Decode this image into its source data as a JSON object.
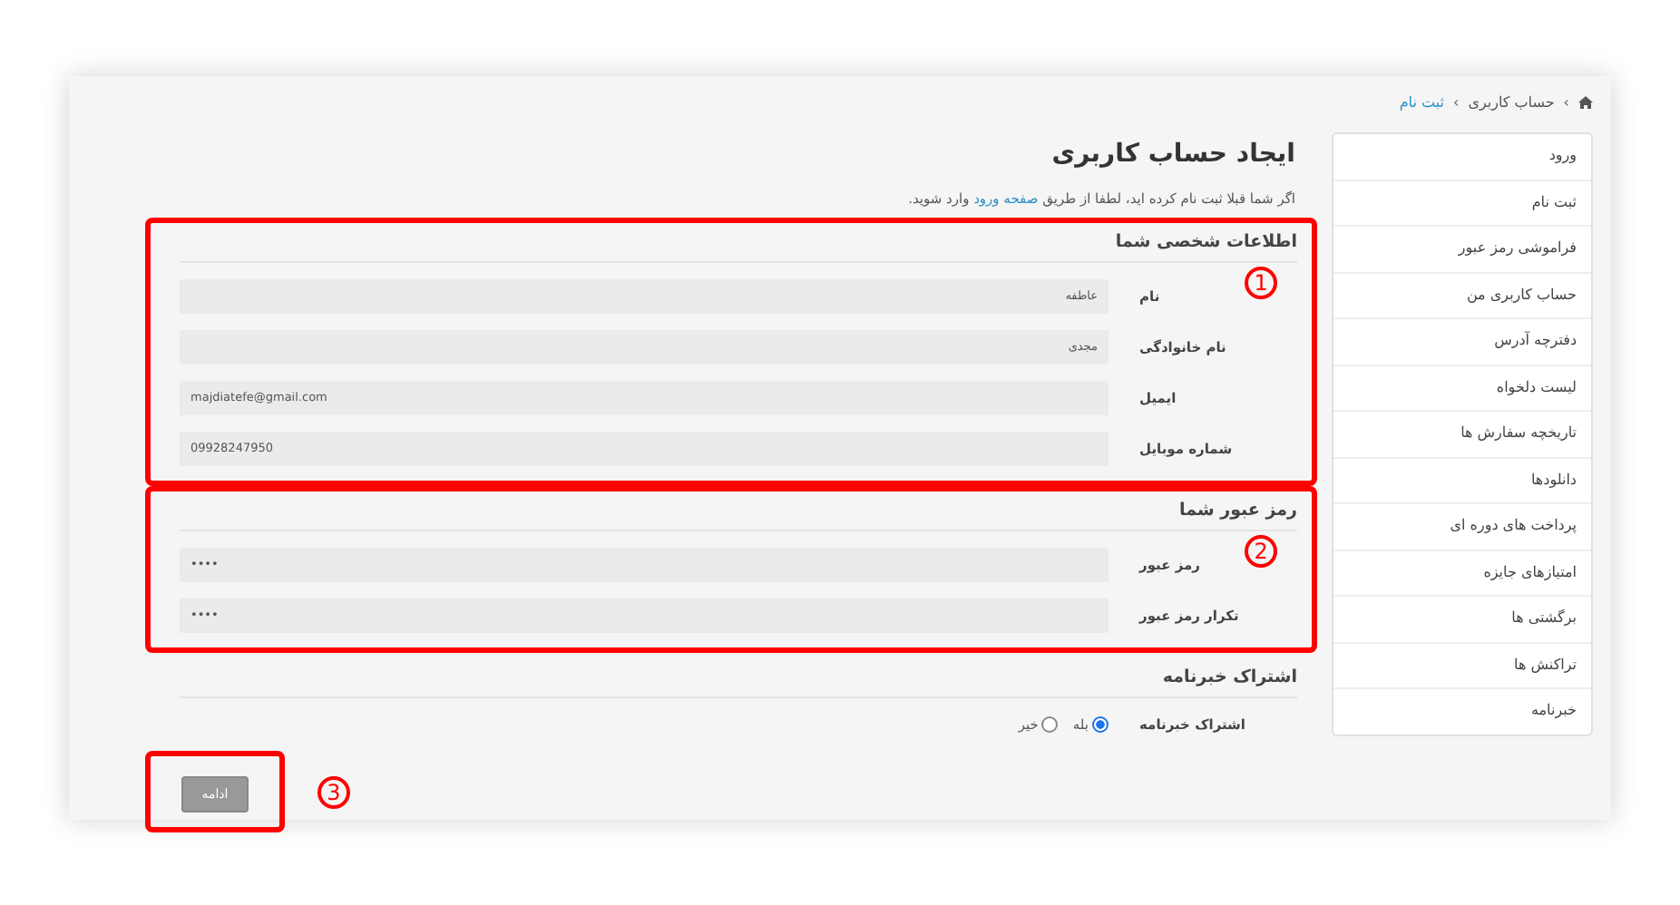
{
  "breadcrumb": [
    {
      "separator": "›",
      "label": "حساب کاربری",
      "current": false
    },
    {
      "separator": "›",
      "label": "ثبت نام",
      "current": true
    }
  ],
  "title": "ایجاد حساب کاربری",
  "intro": {
    "before": "اگر شما قبلا ثبت نام کرده اید، لطفا از طریق",
    "link": "صفحه ورود",
    "after": "وارد شوید."
  },
  "sections": [
    {
      "heading": "اطلاعات شخصی شما",
      "highlighted": true,
      "marker": "1",
      "fields": [
        {
          "label": "نام",
          "value": "عاطفه"
        },
        {
          "label": "نام خانوادگی",
          "value": "مجدی"
        },
        {
          "label": "ایمیل",
          "value": "majdiatefe@gmail.com"
        },
        {
          "label": "شماره موبایل",
          "value": "09928247950"
        }
      ]
    },
    {
      "heading": "رمز عبور شما",
      "highlighted": true,
      "marker": "2",
      "fields": [
        {
          "label": "رمز عبور",
          "value": "••••"
        },
        {
          "label": "تکرار رمز عبور",
          "value": "••••"
        }
      ]
    },
    {
      "heading": "اشتراک خبرنامه",
      "highlighted": false,
      "radio": {
        "label": "اشتراک خبرنامه",
        "options": [
          {
            "label": "بله",
            "selected": true
          },
          {
            "label": "خیر",
            "selected": false
          }
        ]
      }
    }
  ],
  "submit": {
    "label": "ادامه",
    "highlighted": true,
    "marker": "3"
  },
  "sidebar": [
    {
      "label": "ورود"
    },
    {
      "label": "ثبت نام"
    },
    {
      "label": "فراموشی رمز عبور"
    },
    {
      "label": "حساب کاربری من"
    },
    {
      "label": "دفترچه آدرس"
    },
    {
      "label": "لیست دلخواه"
    },
    {
      "label": "تاریخچه سفارش ها"
    },
    {
      "label": "دانلودها"
    },
    {
      "label": "پرداخت های دوره ای"
    },
    {
      "label": "امتیازهای جایزه"
    },
    {
      "label": "برگشتی ها"
    },
    {
      "label": "تراکنش ها"
    },
    {
      "label": "خبرنامه"
    }
  ]
}
